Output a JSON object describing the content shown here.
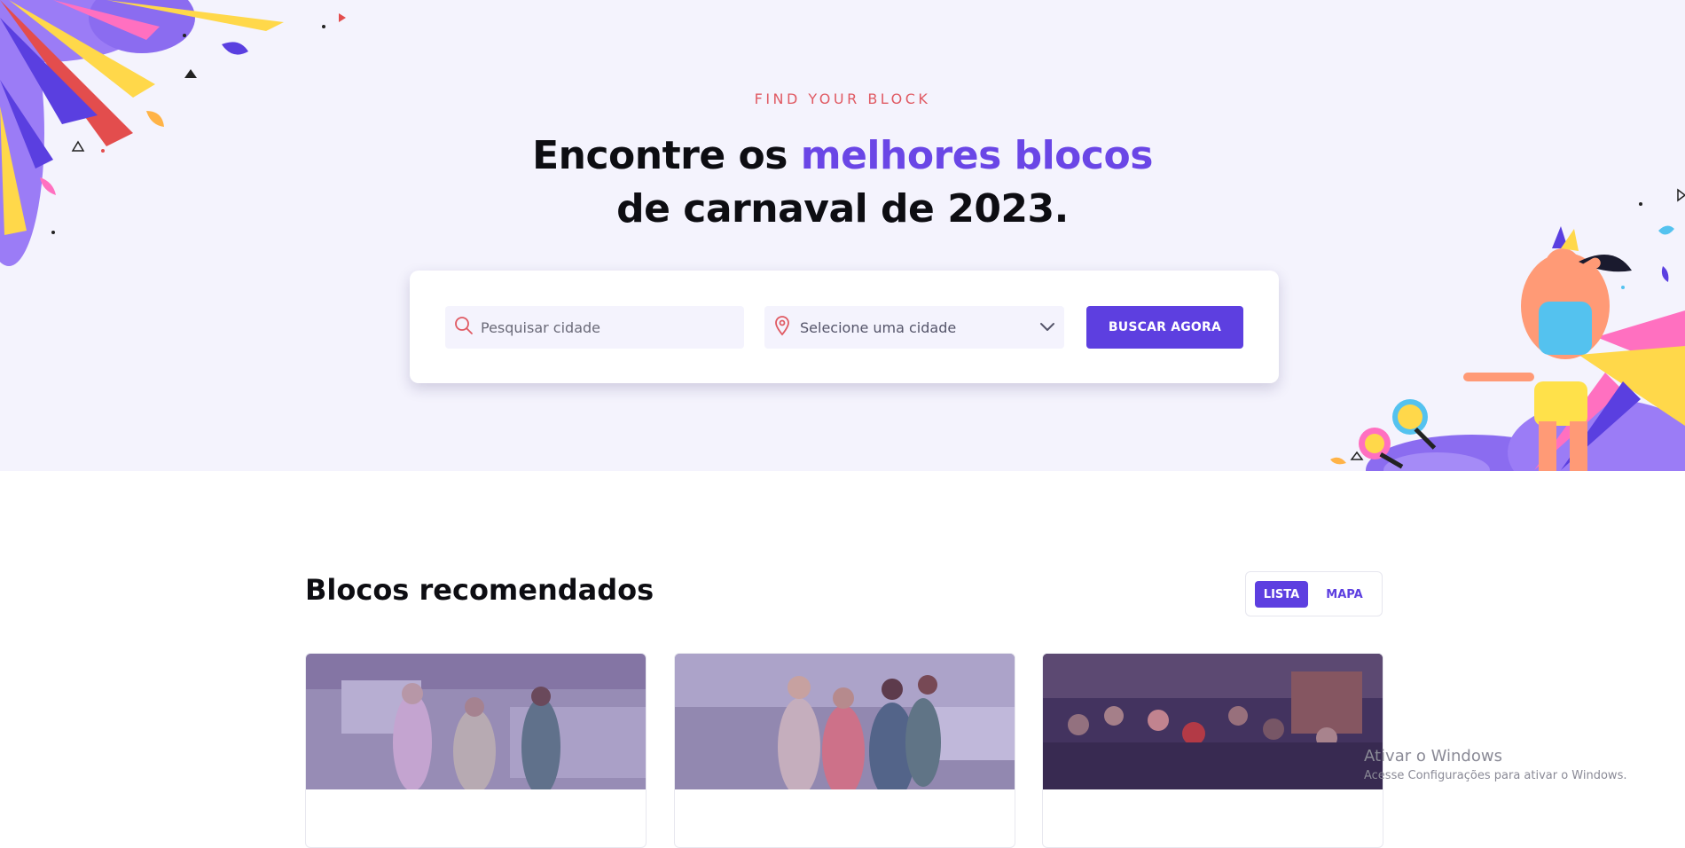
{
  "hero": {
    "eyebrow": "FIND YOUR BLOCK",
    "title_part1": "Encontre os ",
    "title_accent": "melhores blocos",
    "title_part2": "de carnaval de 2023."
  },
  "search": {
    "search_placeholder": "Pesquisar cidade",
    "city_select_value": "Selecione uma cidade",
    "submit_label": "BUSCAR AGORA"
  },
  "recommended": {
    "title": "Blocos recomendados",
    "view_toggle": {
      "list_label": "LISTA",
      "map_label": "MAPA",
      "active": "LISTA"
    },
    "cards": [
      {
        "image": "carnival-group-street-photo"
      },
      {
        "image": "carnival-friends-costumes-photo"
      },
      {
        "image": "carnival-crowd-party-photo"
      }
    ]
  },
  "system_watermark": {
    "line1": "Ativar o Windows",
    "line2": "Acesse Configurações para ativar o Windows."
  },
  "colors": {
    "accent": "#5d3fe0",
    "accent_text": "#6a46e6",
    "eyebrow": "#e05a63",
    "hero_bg": "#f4f3fd"
  }
}
